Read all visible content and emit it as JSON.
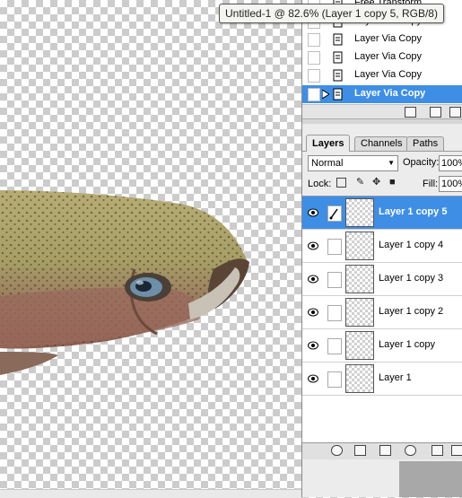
{
  "window": {
    "title_tooltip": "Untitled-1 @ 82.6% (Layer 1 copy 5, RGB/8)"
  },
  "history": {
    "items": [
      {
        "label": "Free Transform",
        "selected": false,
        "icon": "history-step-icon"
      },
      {
        "label": "Layer Via Copy",
        "selected": false,
        "icon": "history-step-icon"
      },
      {
        "label": "Layer Via Copy",
        "selected": false,
        "icon": "history-step-icon"
      },
      {
        "label": "Layer Via Copy",
        "selected": false,
        "icon": "history-step-icon"
      },
      {
        "label": "Layer Via Copy",
        "selected": false,
        "icon": "history-step-icon"
      },
      {
        "label": "Layer Via Copy",
        "selected": true,
        "icon": "history-step-icon"
      }
    ]
  },
  "layers_panel": {
    "tabs": [
      {
        "label": "Layers",
        "active": true
      },
      {
        "label": "Channels",
        "active": false
      },
      {
        "label": "Paths",
        "active": false
      }
    ],
    "blend_mode": "Normal",
    "opacity_label": "Opacity:",
    "opacity_value": "100%",
    "lock_label": "Lock:",
    "fill_label": "Fill:",
    "fill_value": "100%",
    "layers": [
      {
        "name": "Layer 1 copy 5",
        "selected": true,
        "visible": true
      },
      {
        "name": "Layer 1 copy 4",
        "selected": false,
        "visible": true
      },
      {
        "name": "Layer 1 copy 3",
        "selected": false,
        "visible": true
      },
      {
        "name": "Layer 1 copy 2",
        "selected": false,
        "visible": true
      },
      {
        "name": "Layer 1 copy",
        "selected": false,
        "visible": true
      },
      {
        "name": "Layer 1",
        "selected": false,
        "visible": true
      }
    ]
  },
  "colors": {
    "selection": "#3e8ee6",
    "panel_bg": "#ececec"
  }
}
